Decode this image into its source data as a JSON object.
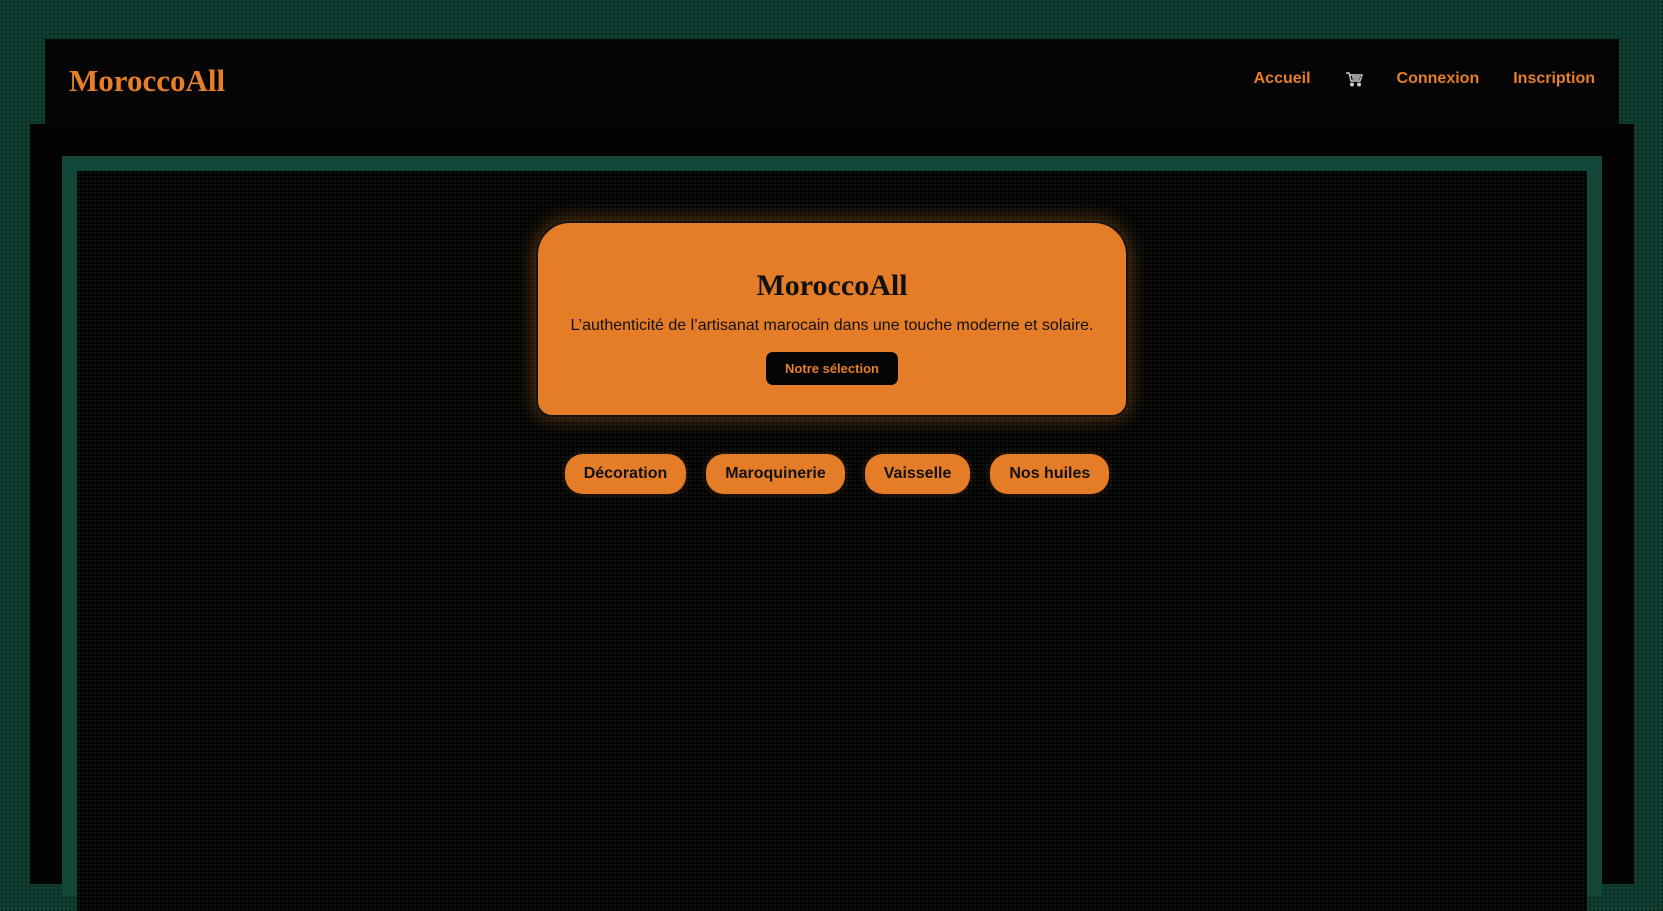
{
  "header": {
    "logo": "MoroccoAll",
    "nav": {
      "home": "Accueil",
      "cart_icon": "shopping-cart-icon",
      "login": "Connexion",
      "register": "Inscription"
    }
  },
  "hero": {
    "title": "MoroccoAll",
    "subtitle": "L’authenticité de l’artisanat marocain dans une touche moderne et solaire.",
    "button": "Notre sélection"
  },
  "categories": [
    {
      "label": "Décoration"
    },
    {
      "label": "Maroquinerie"
    },
    {
      "label": "Vaisselle"
    },
    {
      "label": "Nos huiles"
    }
  ],
  "colors": {
    "accent": "#e57c28",
    "background_green": "#0f3d32",
    "panel": "#050505"
  }
}
